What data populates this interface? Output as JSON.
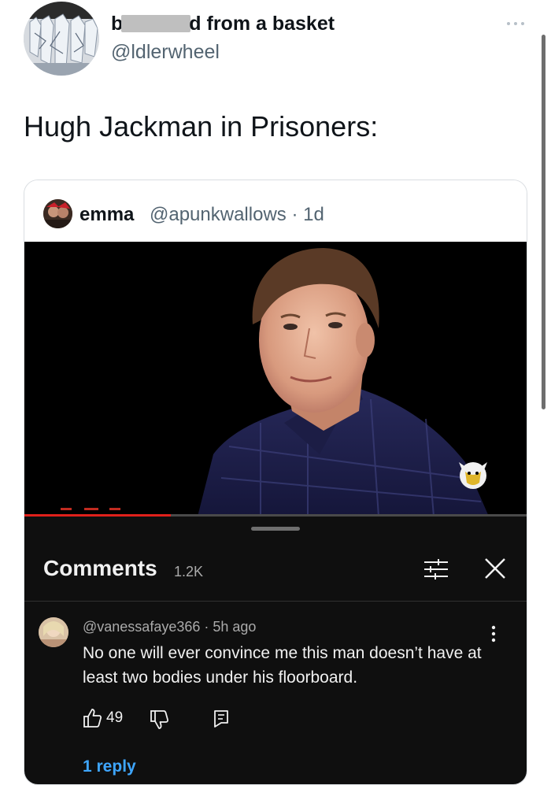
{
  "tweet": {
    "display_name_start": "b",
    "display_name_end": "d from a basket",
    "handle": "@ldlerwheel",
    "text": "Hugh Jackman in Prisoners:"
  },
  "quote": {
    "name": "emma",
    "handle_and_time": "@apunkwallows · 1d"
  },
  "comments": {
    "title": "Comments",
    "count": "1.2K",
    "items": [
      {
        "meta": "@vanessafaye366 · 5h ago",
        "text": "No one will ever convince me this man doesn’t have at least two bodies under his floorboard.",
        "likes": "49",
        "replies_label": "1 reply"
      }
    ]
  },
  "video": {
    "progress": 0.29
  },
  "colors": {
    "link_blue": "#3ea6ff",
    "progress_red": "#e0201b",
    "panel_bg": "#0f0f0f",
    "secondary_text": "#536471"
  },
  "icons": [
    "more-icon",
    "filter-icon",
    "close-icon",
    "kebab-icon",
    "thumbs-up-icon",
    "thumbs-down-icon",
    "reply-icon",
    "channel-logo-icon"
  ]
}
